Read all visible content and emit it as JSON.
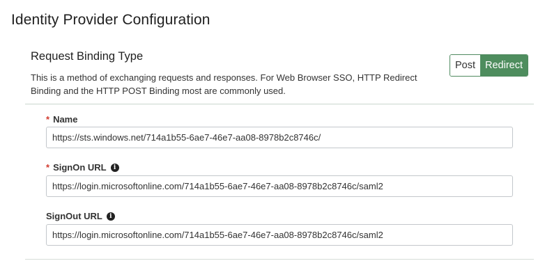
{
  "page": {
    "title": "Identity Provider Configuration"
  },
  "binding": {
    "title": "Request Binding Type",
    "description": "This is a method of exchanging requests and responses. For Web Browser SSO, HTTP Redirect Binding and the HTTP POST Binding most are commonly used.",
    "options": [
      "Post",
      "Redirect"
    ],
    "selected": "Redirect",
    "accent_color": "#4e8d5e"
  },
  "fields": {
    "name": {
      "label": "Name",
      "required_mark": "*",
      "value": "https://sts.windows.net/714a1b55-6ae7-46e7-aa08-8978b2c8746c/"
    },
    "signon_url": {
      "label": "SignOn URL",
      "required_mark": "*",
      "info_icon": "info-circle",
      "value": "https://login.microsoftonline.com/714a1b55-6ae7-46e7-aa08-8978b2c8746c/saml2"
    },
    "signout_url": {
      "label": "SignOut URL",
      "info_icon": "info-circle",
      "value": "https://login.microsoftonline.com/714a1b55-6ae7-46e7-aa08-8978b2c8746c/saml2"
    }
  },
  "colors": {
    "required": "#d23a2f",
    "divider": "#c9d6ce"
  }
}
